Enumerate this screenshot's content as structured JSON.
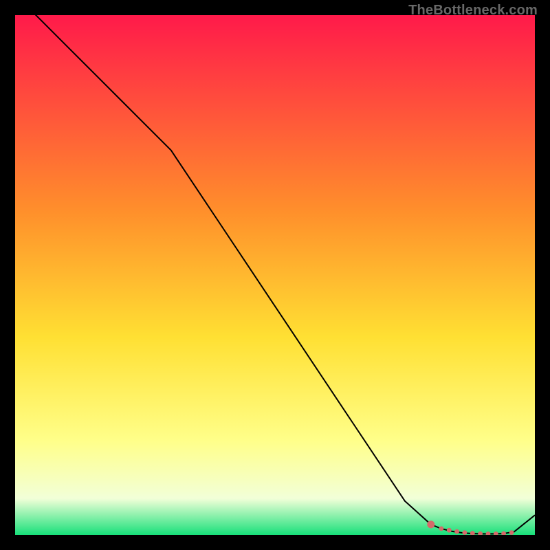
{
  "watermark": "TheBottleneck.com",
  "colors": {
    "bg": "#000000",
    "grad_top": "#ff1a4a",
    "grad_mid1": "#ff6a2b",
    "grad_mid2": "#ffe033",
    "grad_mid3": "#ffff8a",
    "grad_mid4": "#f7ffd0",
    "grad_bottom": "#18e07a",
    "line": "#000000",
    "marker_fill": "#d46a6a",
    "marker_stroke": "#d46a6a"
  },
  "chart_data": {
    "type": "line",
    "title": "",
    "xlabel": "",
    "ylabel": "",
    "xlim": [
      0,
      100
    ],
    "ylim": [
      0,
      100
    ],
    "series": [
      {
        "name": "curve",
        "x": [
          0,
          5,
          10,
          15,
          20,
          25,
          30,
          35,
          40,
          45,
          50,
          55,
          60,
          65,
          70,
          75,
          80,
          82,
          84,
          86,
          88,
          90,
          92,
          94,
          96,
          100
        ],
        "y": [
          104,
          99,
          94,
          89,
          84,
          79,
          74,
          66.5,
          59,
          51.5,
          44,
          36.5,
          29,
          21.5,
          14,
          6.5,
          2.0,
          1.2,
          0.7,
          0.4,
          0.25,
          0.2,
          0.2,
          0.25,
          0.6,
          3.8
        ]
      }
    ],
    "markers": {
      "name": "highlight",
      "x": [
        80,
        82,
        83.5,
        85,
        86.5,
        88,
        89.5,
        91,
        92.5,
        94,
        95.5
      ],
      "y": [
        2.0,
        1.2,
        0.9,
        0.65,
        0.45,
        0.3,
        0.23,
        0.2,
        0.2,
        0.25,
        0.45
      ]
    }
  }
}
